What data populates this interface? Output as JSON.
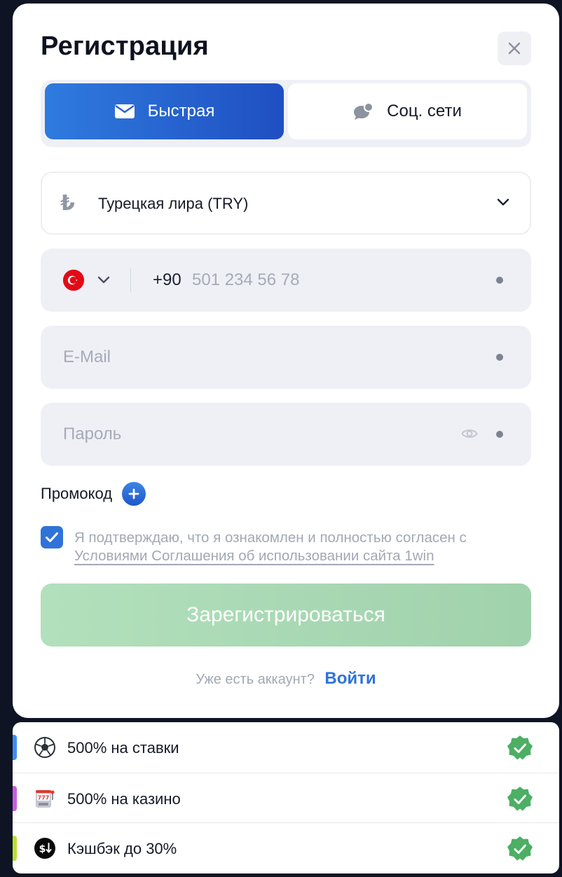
{
  "modal": {
    "title": "Регистрация",
    "tabs": [
      {
        "label": "Быстрая",
        "icon": "envelope-icon",
        "active": true
      },
      {
        "label": "Соц. сети",
        "icon": "chat-bubbles-icon",
        "active": false
      }
    ],
    "currency": {
      "symbol": "₺",
      "label": "Турецкая лира (TRY)"
    },
    "phone": {
      "country_flag": "turkey-flag-icon",
      "prefix": "+90",
      "placeholder": "501 234 56 78"
    },
    "email": {
      "placeholder": "E-Mail"
    },
    "password": {
      "placeholder": "Пароль"
    },
    "promo": {
      "label": "Промокод"
    },
    "agreement": {
      "checked": true,
      "text": "Я подтверждаю, что я ознакомлен и полностью согласен с",
      "link_text": "Условиями Соглашения об использовании сайта 1win"
    },
    "submit_label": "Зарегистрироваться",
    "login": {
      "question": "Уже есть аккаунт?",
      "link": "Войти"
    }
  },
  "bonuses": [
    {
      "label": "500% на ставки",
      "icon": "soccer-ball-icon",
      "accent": "#3b8ef5"
    },
    {
      "label": "500% на казино",
      "icon": "slot-machine-icon",
      "accent": "#c75ee0"
    },
    {
      "label": "Кэшбэк до 30%",
      "icon": "cashback-icon",
      "accent": "#b8e02f"
    }
  ],
  "colors": {
    "primary": "#2f73d9",
    "success": "#4caf64",
    "submit_disabled": "#a9dab5"
  }
}
